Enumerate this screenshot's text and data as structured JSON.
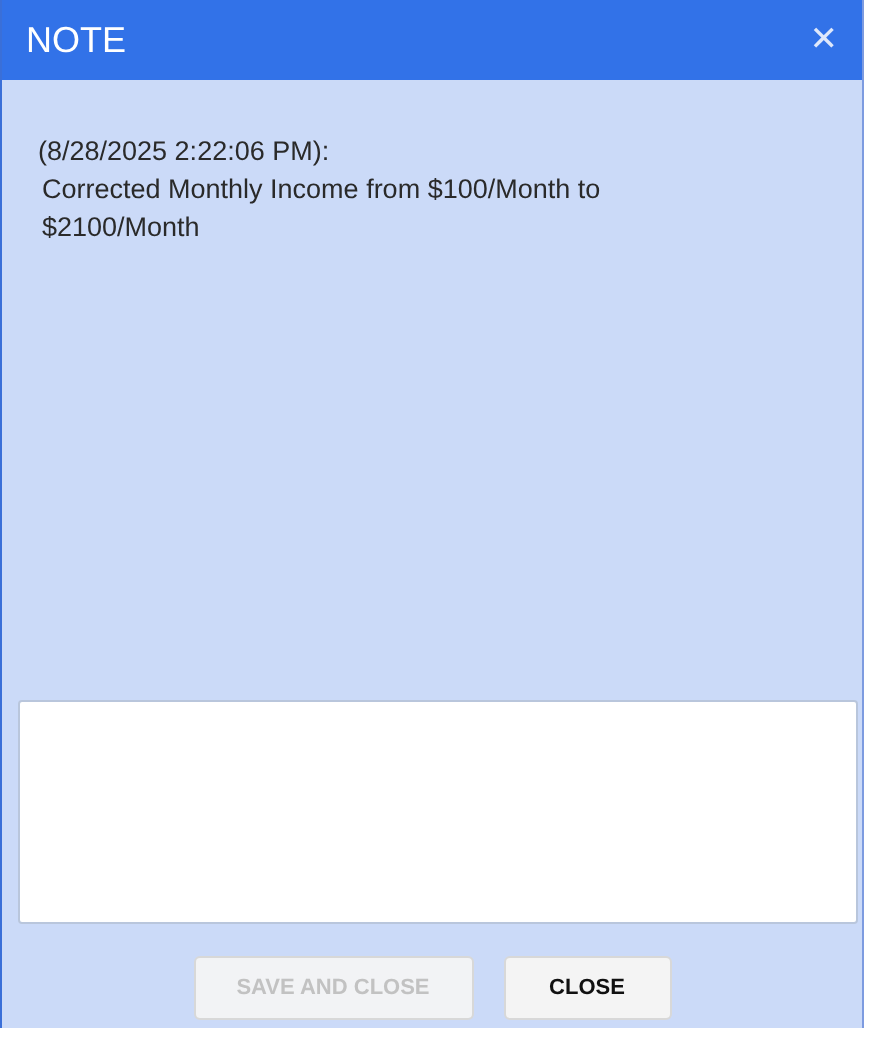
{
  "window": {
    "title": "NOTE",
    "close_icon": "✕"
  },
  "note": {
    "timestamp": "(8/28/2025 2:22:06 PM):",
    "text": "Corrected Monthly Income from $100/Month to $2100/Month"
  },
  "buttons": [
    {
      "label": "SAVE AND CLOSE",
      "disabled": true
    },
    {
      "label": "CLOSE",
      "disabled": false
    }
  ]
}
